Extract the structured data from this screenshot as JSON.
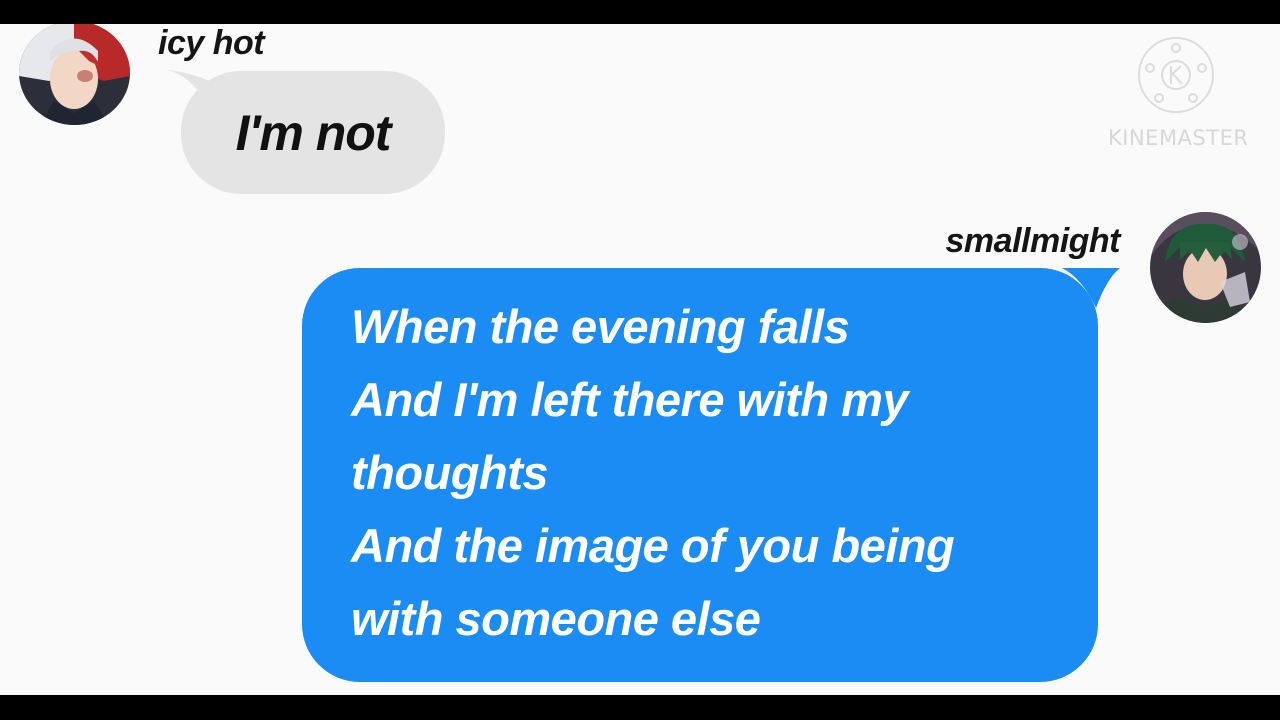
{
  "messages": [
    {
      "sender": "icy hot",
      "side": "left",
      "avatar_icon": "anime-avatar-red-white-hair",
      "text": "I'm not"
    },
    {
      "sender": "smallmight",
      "side": "right",
      "avatar_icon": "anime-avatar-green-hair",
      "lines": [
        "When the evening falls",
        "And I'm left there with my",
        "thoughts",
        "And the image of you being",
        "with someone else"
      ]
    }
  ],
  "watermark": {
    "text": "KINEMASTER",
    "icon": "kinemaster-logo-icon"
  },
  "colors": {
    "blue_bubble": "#1a8cf3",
    "gray_bubble": "#e4e4e4",
    "background": "#fafafa"
  }
}
